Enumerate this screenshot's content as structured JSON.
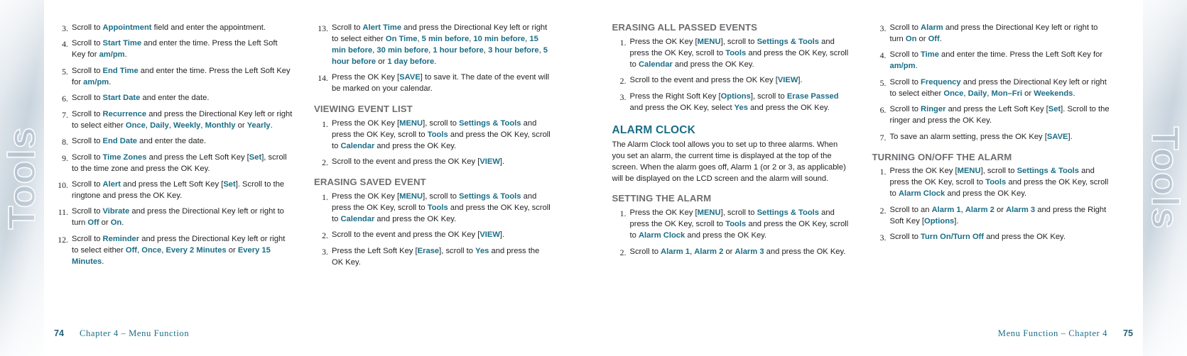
{
  "side_tabs": {
    "left_label": "Tools",
    "right_label": "Tools"
  },
  "colors": {
    "accent_teal": "#1a6e86",
    "subhead_gray": "#6d6f72",
    "body_black": "#231f20"
  },
  "left_page": {
    "page_number": "74",
    "footer_text": "Chapter 4 – Menu Function",
    "column1": {
      "steps": [
        {
          "num": "3.",
          "html": "Scroll to <b class=\"k\">Appointment</b> field and enter the appointment."
        },
        {
          "num": "4.",
          "html": "Scroll to <b class=\"k\">Start Time</b> and enter the time. Press the Left Soft Key for <b class=\"k\">am/pm</b>."
        },
        {
          "num": "5.",
          "html": "Scroll to <b class=\"k\">End Time</b> and enter the time. Press the Left Soft Key for <b class=\"k\">am/pm</b>."
        },
        {
          "num": "6.",
          "html": "Scroll to <b class=\"k\">Start Date</b> and enter the date."
        },
        {
          "num": "7.",
          "html": "Scroll to <b class=\"k\">Recurrence</b> and press the Directional Key left or right to select either <b class=\"k\">Once</b>, <b class=\"k\">Daily</b>, <b class=\"k\">Weekly</b>, <b class=\"k\">Monthly</b> or <b class=\"k\">Yearly</b>."
        },
        {
          "num": "8.",
          "html": "Scroll to <b class=\"k\">End Date</b> and enter the date."
        },
        {
          "num": "9.",
          "html": "Scroll to <b class=\"k\">Time Zones</b> and press the Left Soft Key [<b class=\"k\">Set</b>], scroll to the time zone and press the OK Key."
        },
        {
          "num": "10.",
          "html": "Scroll to <b class=\"k\">Alert</b> and press the Left Soft Key [<b class=\"k\">Set</b>]. Scroll to the ringtone and press the OK Key."
        },
        {
          "num": "11.",
          "html": "Scroll to <b class=\"k\">Vibrate</b> and press the Directional Key left or right to turn <b class=\"k\">Off</b> or <b class=\"k\">On</b>."
        },
        {
          "num": "12.",
          "html": "Scroll to <b class=\"k\">Reminder</b> and press the Directional Key left or right to select either <b class=\"k\">Off</b>, <b class=\"k\">Once</b>, <b class=\"k\">Every 2 Minutes</b> or <b class=\"k\">Every 15 Minutes</b>."
        }
      ]
    },
    "column2": {
      "steps_top": [
        {
          "num": "13.",
          "html": "Scroll to <b class=\"k\">Alert Time</b> and press the Directional Key left or right to select either <b class=\"k\">On Time</b>, <b class=\"k\">5 min before</b>, <b class=\"k\">10 min before</b>, <b class=\"k\">15 min before</b>, <b class=\"k\">30 min before</b>, <b class=\"k\">1 hour before</b>, <b class=\"k\">3 hour before</b>, <b class=\"k\">5 hour before</b> or <b class=\"k\">1 day before</b>."
        },
        {
          "num": "14.",
          "html": "Press the OK Key [<b class=\"k\">SAVE</b>] to save it. The date of the event will be marked on your calendar."
        }
      ],
      "heading_viewing": "VIEWING EVENT LIST",
      "steps_viewing": [
        {
          "num": "1.",
          "html": "Press the OK Key [<b class=\"k\">MENU</b>], scroll to <b class=\"k\">Settings &amp; Tools</b> and press the OK Key, scroll to <b class=\"k\">Tools</b> and press the OK Key, scroll to <b class=\"k\">Calendar</b> and press the OK Key."
        },
        {
          "num": "2.",
          "html": "Scroll to the event and press the OK Key [<b class=\"k\">VIEW</b>]."
        }
      ],
      "heading_erasing": "ERASING SAVED EVENT",
      "steps_erasing": [
        {
          "num": "1.",
          "html": "Press the OK Key [<b class=\"k\">MENU</b>], scroll to <b class=\"k\">Settings &amp; Tools</b> and press the OK Key, scroll to <b class=\"k\">Tools</b> and press the OK Key, scroll to <b class=\"k\">Calendar</b> and press the OK Key."
        },
        {
          "num": "2.",
          "html": "Scroll to the event and press the OK Key [<b class=\"k\">VIEW</b>]."
        },
        {
          "num": "3.",
          "html": "Press the Left Soft Key [<b class=\"k\">Erase</b>], scroll to <b class=\"k\">Yes</b> and press the OK Key."
        }
      ]
    }
  },
  "right_page": {
    "page_number": "75",
    "footer_text": "Menu Function – Chapter 4",
    "column3": {
      "heading_erasing_all": "ERASING ALL PASSED EVENTS",
      "steps_erasing_all": [
        {
          "num": "1.",
          "html": "Press the OK Key [<b class=\"k\">MENU</b>], scroll to <b class=\"k\">Settings &amp; Tools</b> and press the OK Key, scroll to <b class=\"k\">Tools</b> and press the OK Key, scroll to <b class=\"k\">Calendar</b> and press the OK Key."
        },
        {
          "num": "2.",
          "html": "Scroll to the event and press the OK Key [<b class=\"k\">VIEW</b>]."
        },
        {
          "num": "3.",
          "html": "Press the Right Soft Key [<b class=\"k\">Options</b>], scroll to <b class=\"k\">Erase Passed</b> and press the OK Key, select <b class=\"k\">Yes</b> and press the OK Key."
        }
      ],
      "heading_alarm_clock": "ALARM CLOCK",
      "intro_paragraph": "The Alarm Clock tool allows you to set up to three alarms. When you set an alarm, the current time is displayed at the top of the screen. When the alarm goes off, Alarm 1 (or 2 or 3, as applicable) will be displayed on the LCD screen and the alarm will sound.",
      "heading_setting_alarm": "SETTING THE ALARM",
      "steps_setting_alarm": [
        {
          "num": "1.",
          "html": "Press the OK Key [<b class=\"k\">MENU</b>], scroll to <b class=\"k\">Settings &amp; Tools</b> and press the OK Key, scroll to <b class=\"k\">Tools</b> and press the OK Key, scroll to <b class=\"k\">Alarm Clock</b> and press the OK Key."
        },
        {
          "num": "2.",
          "html": "Scroll to <b class=\"k\">Alarm 1</b>, <b class=\"k\">Alarm 2</b> or <b class=\"k\">Alarm 3</b> and press the OK Key."
        }
      ]
    },
    "column4": {
      "steps_setting_alarm_cont": [
        {
          "num": "3.",
          "html": "Scroll to <b class=\"k\">Alarm</b> and press the Directional Key left or right to turn <b class=\"k\">On</b> or <b class=\"k\">Off</b>."
        },
        {
          "num": "4.",
          "html": "Scroll to <b class=\"k\">Time</b> and enter the time. Press the Left Soft Key for <b class=\"k\">am/pm</b>."
        },
        {
          "num": "5.",
          "html": "Scroll to <b class=\"k\">Frequency</b> and press the Directional Key left or right to select either <b class=\"k\">Once</b>, <b class=\"k\">Daily</b>, <b class=\"k\">Mon–Fri</b> or <b class=\"k\">Weekends</b>."
        },
        {
          "num": "6.",
          "html": "Scroll to <b class=\"k\">Ringer</b> and press the Left Soft Key [<b class=\"k\">Set</b>]. Scroll to the ringer and press the OK Key."
        },
        {
          "num": "7.",
          "html": "To save an alarm setting, press the OK Key [<b class=\"k\">SAVE</b>]."
        }
      ],
      "heading_turning": "TURNING ON/OFF THE ALARM",
      "steps_turning": [
        {
          "num": "1.",
          "html": "Press the OK Key [<b class=\"k\">MENU</b>], scroll to <b class=\"k\">Settings &amp; Tools</b> and press the OK Key, scroll to <b class=\"k\">Tools</b> and press the OK Key, scroll to <b class=\"k\">Alarm Clock</b> and press the OK Key."
        },
        {
          "num": "2.",
          "html": "Scroll to an <b class=\"k\">Alarm 1</b>, <b class=\"k\">Alarm 2</b> or <b class=\"k\">Alarm 3</b> and press the Right Soft Key [<b class=\"k\">Options</b>]."
        },
        {
          "num": "3.",
          "html": "Scroll to <b class=\"k\">Turn On/Turn Off</b> and press the OK Key."
        }
      ]
    }
  }
}
